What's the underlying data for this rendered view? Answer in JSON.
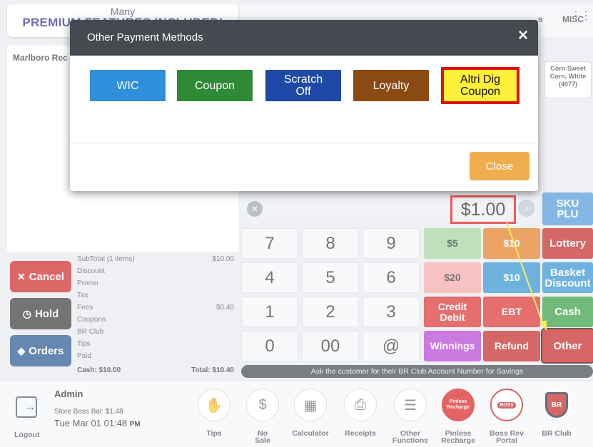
{
  "banner": {
    "line1": "Many",
    "line2": "PREMIUM FEATURES INCLUDED!"
  },
  "categories": {
    "partial": "s",
    "misc": "MISC"
  },
  "order": {
    "item_partial": "Marlboro Rec"
  },
  "product_tile": {
    "line1": "Corn Sweet",
    "line2": "Corn, White",
    "line3": "(4077)"
  },
  "summary": {
    "subtotal_label": "SubTotal (1 items)",
    "subtotal_value": "$10.00",
    "discount_label": "Discount",
    "promo_label": "Promo",
    "tax_label": "Tax",
    "fees_label": "Fees",
    "fees_value": "$0.40",
    "coupons_label": "Coupons",
    "brclub_label": "BR Club",
    "tips_label": "Tips",
    "paid_label": "Paid",
    "cash_label": "Cash: $10.00",
    "total_label": "Total: $10.40"
  },
  "side_buttons": {
    "cancel": "Cancel",
    "hold": "Hold",
    "orders": "Orders"
  },
  "amount": "$1.00",
  "keypad": [
    "7",
    "8",
    "9",
    "4",
    "5",
    "6",
    "1",
    "2",
    "3",
    "0",
    "00",
    "@"
  ],
  "payments": {
    "five": "$5",
    "ten_partial": "$10",
    "twenty": "$20",
    "ten": "$10",
    "credit": "Credit",
    "debit": "Debit",
    "ebt": "EBT",
    "winnings": "Winnings",
    "refund": "Refund",
    "sku1": "SKU",
    "sku2": "PLU",
    "lottery": "Lottery",
    "basket1": "Basket",
    "basket2": "Discount",
    "cash": "Cash",
    "other": "Other"
  },
  "hint": "Ask the customer for their BR Club Account Number for Savings",
  "admin": {
    "name": "Admin",
    "balance": "Store Boss Bal: $1.48",
    "time": "Tue Mar 01 01:48",
    "ampm": "PM"
  },
  "tools": {
    "logout": "Logout",
    "tips": "Tips",
    "no_sale_1": "No",
    "no_sale_2": "Sale",
    "calculator": "Calculator",
    "receipts": "Receipts",
    "other_1": "Other",
    "other_2": "Functions",
    "pinless_icon_1": "Pinless",
    "pinless_icon_2": "Recharge",
    "pinless_1": "Pinless",
    "pinless_2": "Recharge",
    "boss_icon": "BOSS",
    "bossrev_1": "Boss Rev",
    "bossrev_2": "Portal",
    "brclub_icon": "BR",
    "brclub": "BR Club"
  },
  "modal": {
    "title": "Other Payment Methods",
    "close_x": "×",
    "methods": [
      {
        "line1": "WIC",
        "line2": ""
      },
      {
        "line1": "Coupon",
        "line2": ""
      },
      {
        "line1": "Scratch",
        "line2": "Off"
      },
      {
        "line1": "Loyalty",
        "line2": ""
      },
      {
        "line1": "Altri Dig",
        "line2": "Coupon"
      }
    ],
    "close_label": "Close"
  },
  "colors": {
    "wic": "#2e8fdb",
    "coupon": "#2f8a35",
    "scratch": "#1f49a6",
    "loyalty": "#8b4a12",
    "altri": "#ffef3a",
    "close": "#f0ad4e",
    "highlight": "#e01010",
    "arrow": "#f2e21a"
  }
}
